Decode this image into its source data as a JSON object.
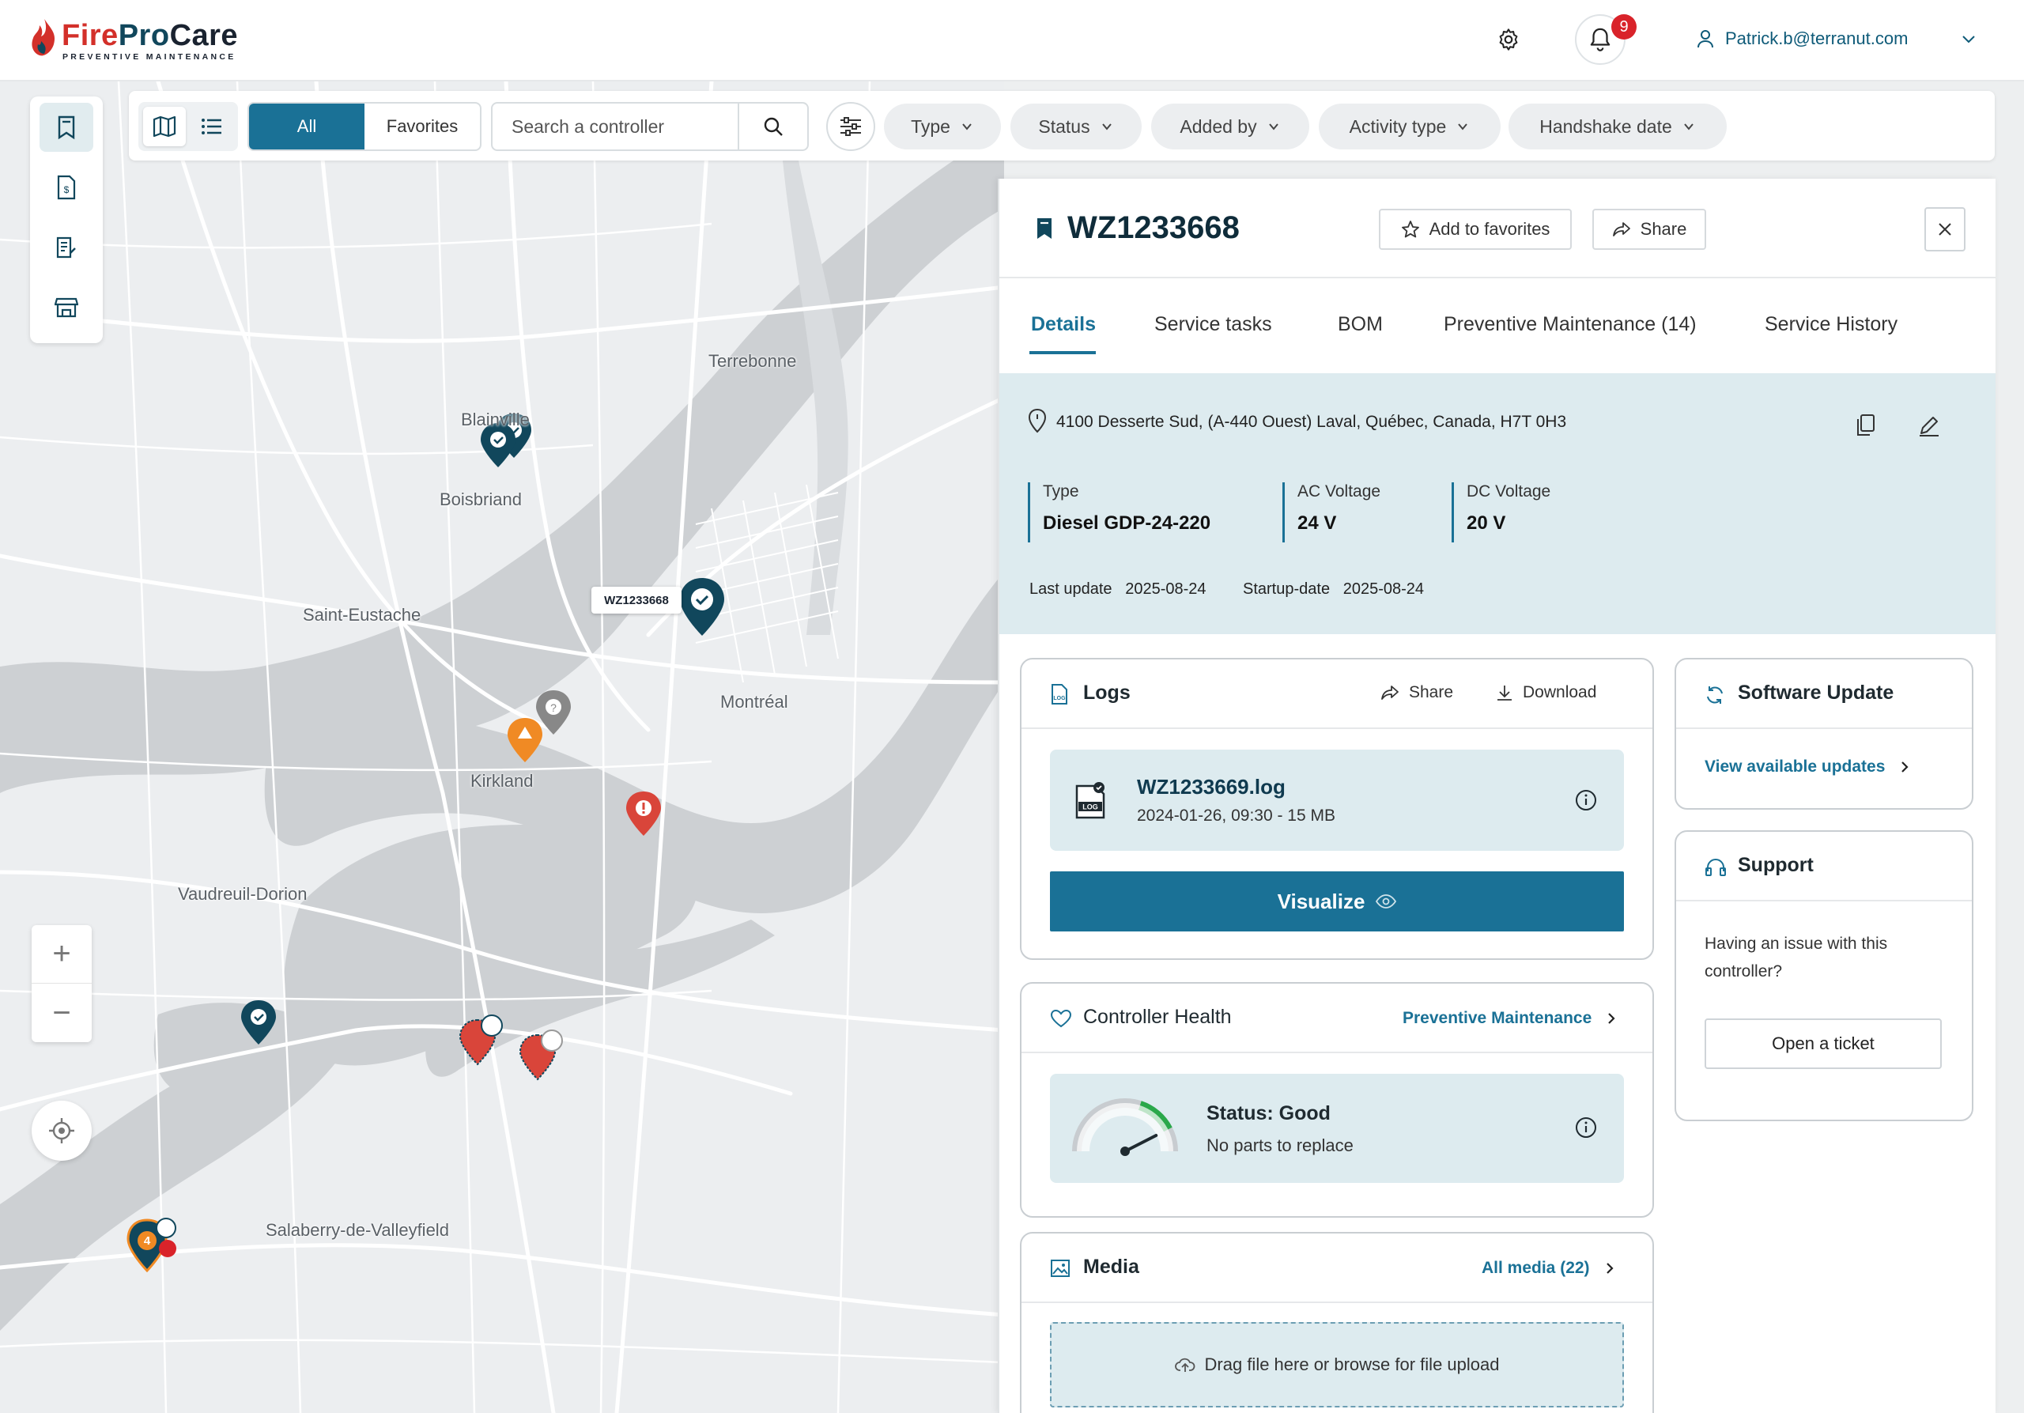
{
  "brand": {
    "name_part1": "Fire",
    "name_part2": "Pro",
    "name_part3": "Care",
    "tagline": "PREVENTIVE MAINTENANCE",
    "colors": {
      "red": "#d3302a",
      "navy": "#11475c",
      "accent": "#1a7196"
    }
  },
  "header": {
    "notification_count": "9",
    "user_email": "Patrick.b@terranut.com",
    "icons": [
      "gear-icon",
      "bell-icon",
      "user-icon",
      "chevron-down-icon"
    ]
  },
  "sidebar": {
    "items": [
      {
        "icon": "bookmark-icon"
      },
      {
        "icon": "invoice-icon"
      },
      {
        "icon": "report-icon"
      },
      {
        "icon": "store-icon"
      }
    ]
  },
  "toolbar": {
    "segments": {
      "all": "All",
      "favorites": "Favorites"
    },
    "search_placeholder": "Search a controller",
    "filters": {
      "type": "Type",
      "status": "Status",
      "added_by": "Added by",
      "activity_type": "Activity type",
      "handshake_date": "Handshake date"
    }
  },
  "map": {
    "cities": {
      "terrebonne": "Terrebonne",
      "blainville": "Blainville",
      "boisbriand": "Boisbriand",
      "saint_eustache": "Saint-Eustache",
      "montreal": "Montréal",
      "kirkland": "Kirkland",
      "vaudreuil": "Vaudreuil-Dorion",
      "salaberry": "Salaberry-de-Valleyfield"
    },
    "selected_pin_label": "WZ1233668",
    "cluster_count": "4",
    "controls": {
      "zoom_in": "+",
      "zoom_out": "−"
    }
  },
  "panel": {
    "title": "WZ1233668",
    "add_favorites": "Add to favorites",
    "share": "Share",
    "tabs": [
      "Details",
      "Service tasks",
      "BOM",
      "Preventive Maintenance (14)",
      "Service History"
    ],
    "address": "4100 Desserte Sud, (A-440 Ouest) Laval, Québec, Canada, H7T 0H3",
    "specs": [
      {
        "label": "Type",
        "value": "Diesel GDP-24-220"
      },
      {
        "label": "AC Voltage",
        "value": "24 V"
      },
      {
        "label": "DC Voltage",
        "value": "20 V"
      }
    ],
    "last_update_label": "Last update",
    "last_update": "2025-08-24",
    "startup_label": "Startup-date",
    "startup_date": "2025-08-24",
    "logs": {
      "title": "Logs",
      "share": "Share",
      "download": "Download",
      "file_name": "WZ1233669.log",
      "file_meta": "2024-01-26, 09:30 - 15 MB",
      "visualize": "Visualize"
    },
    "health": {
      "title": "Controller Health",
      "link": "Preventive Maintenance",
      "status": "Status: Good",
      "sub": "No parts to replace",
      "level": 0.85
    },
    "media": {
      "title": "Media",
      "link": "All media (22)",
      "upload": "Drag file here or browse for file upload"
    },
    "software": {
      "title": "Software Update",
      "link": "View available updates"
    },
    "support": {
      "title": "Support",
      "text": "Having an issue with this controller?",
      "button": "Open a ticket"
    }
  }
}
